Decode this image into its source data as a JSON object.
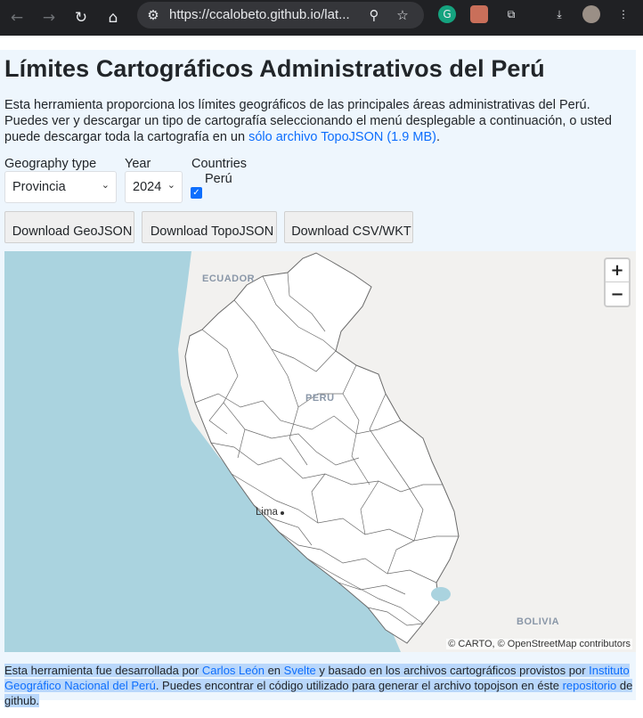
{
  "browser": {
    "url": "https://ccalobeto.github.io/lat...",
    "icons": [
      "back-icon",
      "forward-icon",
      "reload-icon",
      "home-icon",
      "site-info-icon",
      "zoom-icon",
      "bookmark-star-icon",
      "grammarly-icon",
      "extension-avatar-icon",
      "extensions-puzzle-icon",
      "download-icon",
      "profile-avatar-icon",
      "menu-kebab-icon"
    ]
  },
  "page": {
    "title": "Límites Cartográficos Administrativos del Perú",
    "intro_text": "Esta herramienta proporciona los límites geográficos de las principales áreas administrativas del Perú. Puedes ver y descargar un tipo de cartografía seleccionando el menú desplegable a continuación, o usted puede descargar toda la cartografía en un ",
    "intro_link": "sólo archivo TopoJSON (1.9 MB)",
    "intro_end": "."
  },
  "controls": {
    "geography_label": "Geography type",
    "geography_value": "Provincia",
    "year_label": "Year",
    "year_value": "2024",
    "countries_label": "Countries",
    "country_option": "Perú",
    "country_checked": true
  },
  "buttons": {
    "geojson": "Download GeoJSON",
    "topojson": "Download TopoJSON",
    "csv": "Download CSV/WKT"
  },
  "map": {
    "labels": {
      "ecuador": "ECUADOR",
      "peru": "PERU",
      "lima": "Lima",
      "bolivia": "BOLIVIA"
    },
    "zoom_in": "+",
    "zoom_out": "−",
    "attribution": "© CARTO, © OpenStreetMap contributors",
    "colors": {
      "ocean": "#aad3df",
      "land": "#f2f1ef",
      "region_fill": "#ffffff",
      "boundary": "#6b6b6b"
    }
  },
  "footer": {
    "t1": "Esta herramienta fue desarrollada por ",
    "l1": "Carlos León",
    "t2": " en ",
    "l2": "Svelte",
    "t3": " y basado en los archivos cartográficos provistos por ",
    "l3": "Instituto Geográfico Nacional del Perú",
    "t4": ". Puedes encontrar el código utilizado para generar el archivo topojson en éste ",
    "l4": "repositorio",
    "t5": " de github."
  }
}
